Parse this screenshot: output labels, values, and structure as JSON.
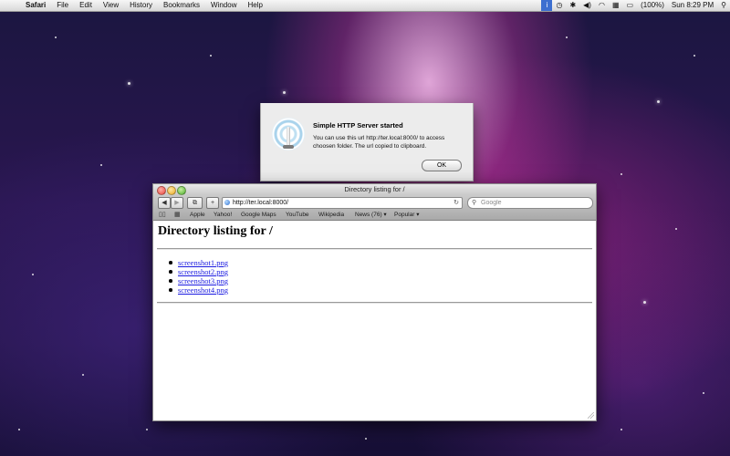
{
  "menubar": {
    "app_name": "Safari",
    "items": [
      "File",
      "Edit",
      "View",
      "History",
      "Bookmarks",
      "Window",
      "Help"
    ],
    "battery": "(100%)",
    "clock": "Sun 8:29 PM"
  },
  "alert": {
    "title": "Simple HTTP Server started",
    "message": "You can use this url http://ter.local:8000/ to access choosen folder. The url copied to clipboard.",
    "ok_label": "OK"
  },
  "browser": {
    "window_title": "Directory listing for /",
    "url": "http://ter.local:8000/",
    "search_placeholder": "Google",
    "bookmarks": [
      "Apple",
      "Yahoo!",
      "Google Maps",
      "YouTube",
      "Wikipedia",
      "News (76) ▾",
      "Popular ▾"
    ],
    "page": {
      "heading": "Directory listing for /",
      "files": [
        "screenshot1.png",
        "screenshot2.png",
        "screenshot3.png",
        "screenshot4.png"
      ]
    }
  },
  "colors": {
    "link": "#1a1ae0",
    "menubar_active": "#3d6fd0"
  }
}
